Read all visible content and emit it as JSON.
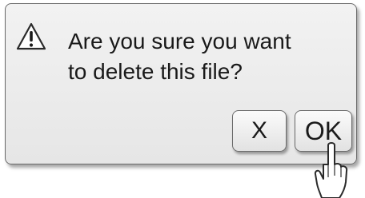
{
  "dialog": {
    "icon": "warning-triangle-icon",
    "message_line1": "Are you sure you want",
    "message_line2": "to delete this file?"
  },
  "buttons": {
    "cancel_label": "X",
    "ok_label": "OK"
  },
  "pointer": {
    "icon": "pointing-finger-icon"
  },
  "colors": {
    "dialog_bg": "#ececec",
    "border": "#6a6a6a",
    "text": "#1a1a1a"
  }
}
